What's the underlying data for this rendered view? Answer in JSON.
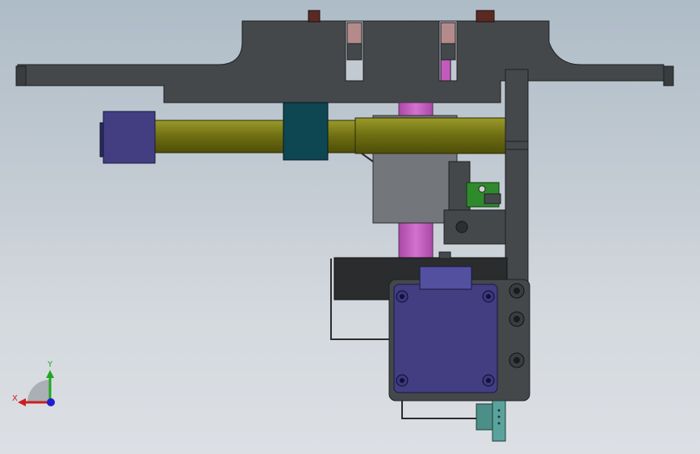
{
  "viewport": {
    "title": "",
    "background_top": "#aebcc7",
    "background_bottom": "#dcdfe4"
  },
  "triad": {
    "x_label": "X",
    "y_label": "Y",
    "x_color": "#cc1f1f",
    "y_color": "#1fa81f",
    "z_color": "#1f1fcc"
  },
  "parts": {
    "frame_color": "#434749",
    "rod_color": "#6a6a10",
    "motor_color": "#433e82",
    "teal_color": "#0e4652",
    "pink_color": "#c25bbd",
    "green_color": "#2f8a2c",
    "connector_color": "#4c8e88",
    "gray_block_color": "#73777c"
  }
}
